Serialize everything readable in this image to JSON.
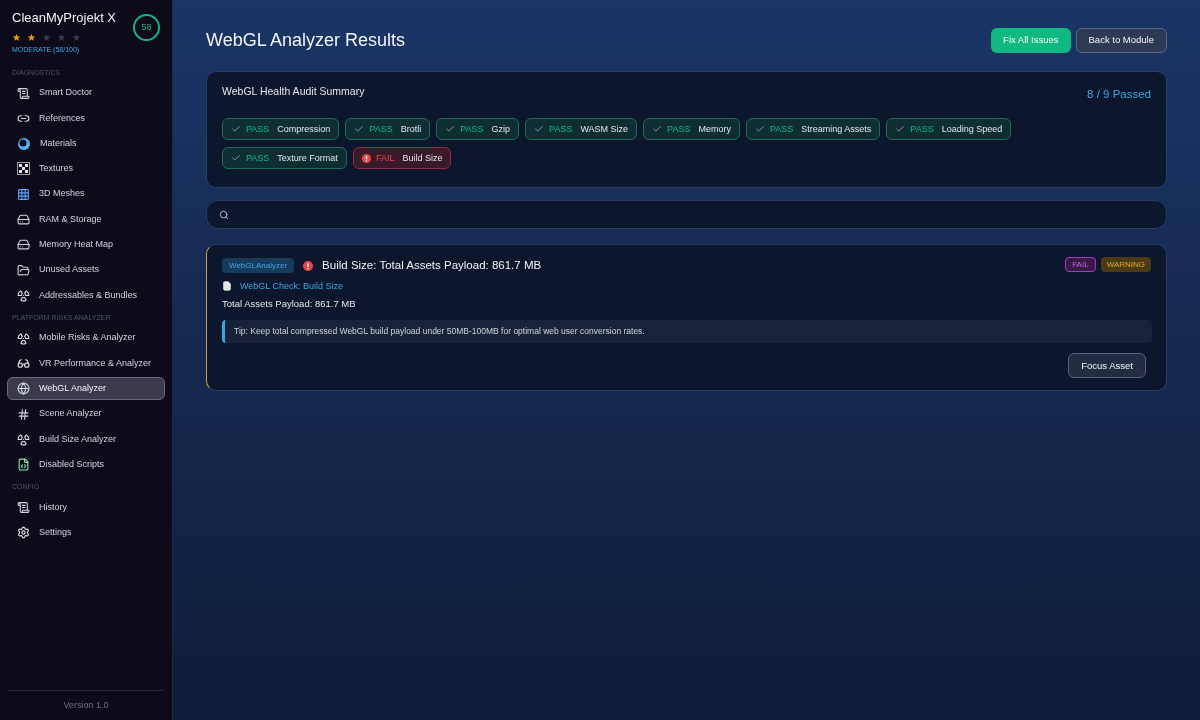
{
  "sidebar": {
    "app_name": "CleanMyProjekt X",
    "stars": 2,
    "rating": "MODERATE (58/100)",
    "score": "58",
    "sections": [
      {
        "title": "DIAGNOSTICS",
        "items": [
          {
            "label": "Smart Doctor",
            "selected": false
          },
          {
            "label": "References",
            "selected": false
          },
          {
            "label": "Materials",
            "selected": false
          },
          {
            "label": "Textures",
            "selected": false
          },
          {
            "label": "3D Meshes",
            "selected": false
          },
          {
            "label": "RAM & Storage",
            "selected": false
          },
          {
            "label": "Memory Heat Map",
            "selected": false
          },
          {
            "label": "Unused Assets",
            "selected": false
          },
          {
            "label": "Addressables & Bundles",
            "selected": false
          }
        ]
      },
      {
        "title": "PLATFORM RISKS ANALYZER",
        "items": [
          {
            "label": "Mobile Risks & Analyzer",
            "selected": false
          },
          {
            "label": "VR Performance & Analyzer",
            "selected": false
          },
          {
            "label": "WebGL Analyzer",
            "selected": true
          },
          {
            "label": "Scene Analyzer",
            "selected": false
          },
          {
            "label": "Build Size Analyzer",
            "selected": false
          },
          {
            "label": "Disabled Scripts",
            "selected": false
          }
        ]
      },
      {
        "title": "CONFIG",
        "items": [
          {
            "label": "History",
            "selected": false
          },
          {
            "label": "Settings",
            "selected": false
          }
        ]
      }
    ],
    "version": "Version 1.0"
  },
  "header": {
    "title": "WebGL Analyzer Results",
    "buttons": [
      {
        "label": "Fix All Issues",
        "kind": "primary"
      },
      {
        "label": "Back to Module",
        "kind": "secondary"
      }
    ]
  },
  "summary": {
    "title": "WebGL Health Audit Summary",
    "passed": "8 / 9 Passed",
    "checks": [
      {
        "status": "PASS",
        "label": "Compression",
        "passed": true
      },
      {
        "status": "PASS",
        "label": "Brotli",
        "passed": true
      },
      {
        "status": "PASS",
        "label": "Gzip",
        "passed": true
      },
      {
        "status": "PASS",
        "label": "WASM Size",
        "passed": true
      },
      {
        "status": "PASS",
        "label": "Memory",
        "passed": true
      },
      {
        "status": "PASS",
        "label": "Streaming Assets",
        "passed": true
      },
      {
        "status": "PASS",
        "label": "Loading Speed",
        "passed": true
      },
      {
        "status": "PASS",
        "label": "Texture Format",
        "passed": true
      },
      {
        "status": "FAIL",
        "label": "Build Size",
        "passed": false
      }
    ]
  },
  "issues": [
    {
      "source": "WebGLAnalyzer",
      "title": "Build Size: Total Assets Payload: 861.7 MB",
      "link": "WebGL Check: Build Size",
      "detail": "Total Assets Payload: 861.7 MB",
      "tip": "Tip: Keep total compressed WebGL build payload under 50MB-100MB for optimal web user conversion rates.",
      "badges": [
        {
          "label": "FAIL",
          "kind": "fail"
        },
        {
          "label": "WARNING",
          "kind": "warning"
        }
      ],
      "action": "Focus Asset"
    }
  ]
}
